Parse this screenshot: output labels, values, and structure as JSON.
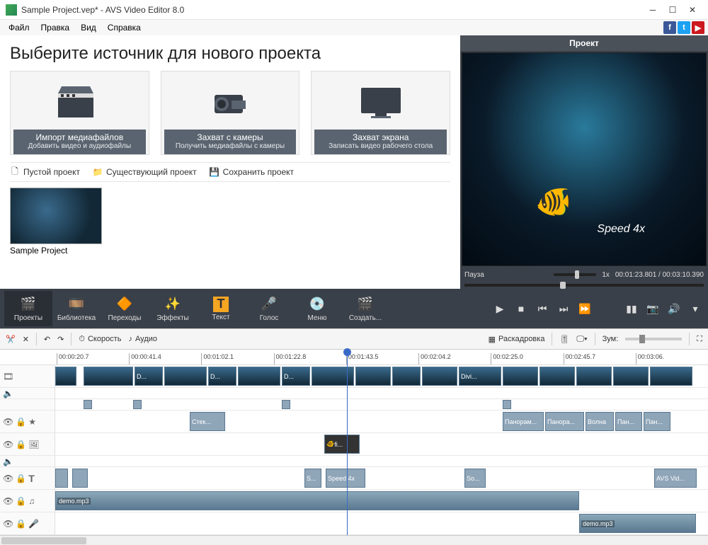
{
  "title": "Sample Project.vep* - AVS Video Editor 8.0",
  "menu": [
    "Файл",
    "Правка",
    "Вид",
    "Справка"
  ],
  "heading": "Выберите источник для нового проекта",
  "cards": [
    {
      "t1": "Импорт медиафайлов",
      "t2": "Добавить видео и аудиофайлы"
    },
    {
      "t1": "Захват с камеры",
      "t2": "Получить медиафайлы с камеры"
    },
    {
      "t1": "Захват экрана",
      "t2": "Записать видео рабочего стола"
    }
  ],
  "proj": {
    "blank": "Пустой проект",
    "existing": "Существующий проект",
    "save": "Сохранить проект"
  },
  "thumb_label": "Sample Project",
  "preview": {
    "title": "Проект",
    "speed": "Speed 4x",
    "status": "Пауза",
    "rate": "1x",
    "time": "00:01:23.801 / 00:03:10.390"
  },
  "toolbar": [
    "Проекты",
    "Библиотека",
    "Переходы",
    "Эффекты",
    "Текст",
    "Голос",
    "Меню",
    "Создать..."
  ],
  "sec": {
    "speed": "Скорость",
    "audio": "Аудио",
    "story": "Раскадровка",
    "zoom": "Зум:"
  },
  "ruler": [
    "00:00:20.7",
    "00:00:41.4",
    "00:01:02.1",
    "00:01:22.8",
    "00:01:43.5",
    "00:02:04.2",
    "00:02:25.0",
    "00:02:45.7",
    "00:03:06."
  ],
  "clips": {
    "fx1": "Стек...",
    "fx2": "Панорам...",
    "fx3": "Панора...",
    "fx4": "Волна",
    "fx5": "Пан...",
    "fx6": "Пан...",
    "ov": "fi...",
    "tx1": "S...",
    "tx2": "Speed 4x",
    "tx3": "So...",
    "tx4": "AVS Vid...",
    "a1": "demo.mp3",
    "a2": "demo.mp3",
    "vd": "D...",
    "divi": "Divi..."
  }
}
